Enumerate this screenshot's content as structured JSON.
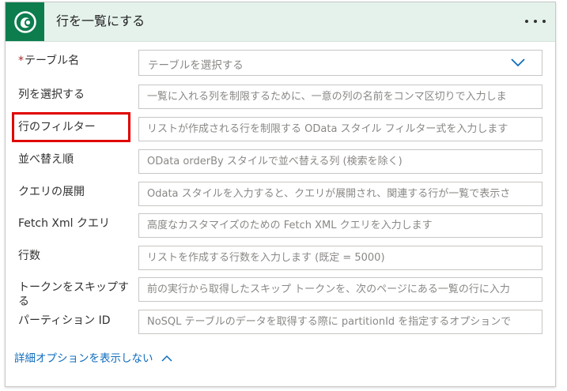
{
  "header": {
    "title": "行を一覧にする",
    "icon": "dataverse-icon",
    "more": "ellipsis-icon",
    "accent": "#0d7d4e"
  },
  "fields": [
    {
      "label": "テーブル名",
      "required": true,
      "type": "select",
      "value": "テーブルを選択する"
    },
    {
      "label": "列を選択する",
      "placeholder": "一覧に入れる列を制限するために、一意の列の名前をコンマ区切りで入力しま"
    },
    {
      "label": "行のフィルター",
      "placeholder": "リストが作成される行を制限する OData スタイル フィルター式を入力します"
    },
    {
      "label": "並べ替え順",
      "placeholder": "OData orderBy スタイルで並べ替える列 (検索を除く)"
    },
    {
      "label": "クエリの展開",
      "placeholder": "Odata スタイルを入力すると、クエリが展開され、関連する行が一覧で表示さ"
    },
    {
      "label": "Fetch Xml クエリ",
      "placeholder": "高度なカスタマイズのための Fetch XML クエリを入力します"
    },
    {
      "label": "行数",
      "placeholder": "リストを作成する行数を入力します (既定 = 5000)"
    },
    {
      "label": "トークンをスキップする",
      "placeholder": "前の実行から取得したスキップ トークンを、次のページにある一覧の行に入力"
    },
    {
      "label": "パーティション ID",
      "placeholder": "NoSQL テーブルのデータを取得する際に partitionId を指定するオプションで"
    }
  ],
  "advanced_toggle": "詳細オプションを表示しない",
  "highlight_color": "#e00000"
}
